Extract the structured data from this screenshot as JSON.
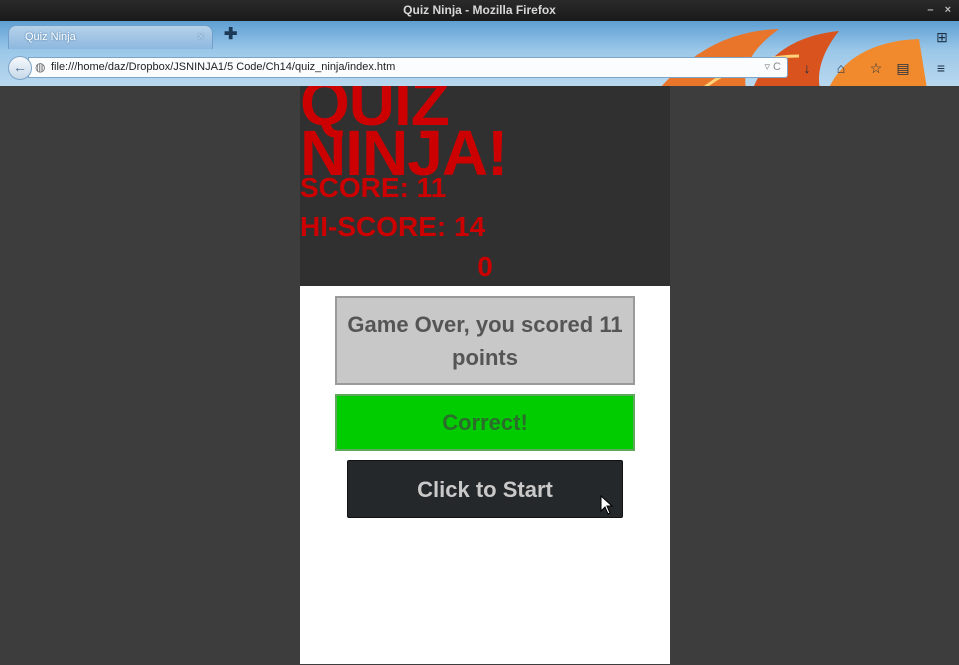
{
  "window": {
    "title": "Quiz Ninja - Mozilla Firefox",
    "controls": "– ×"
  },
  "browser": {
    "tab_label": "Quiz Ninja",
    "tab_close": "×",
    "new_tab": "✚",
    "back": "←",
    "url": "file:///home/daz/Dropbox/JSNINJA1/5 Code/Ch14/quiz_ninja/index.htm",
    "url_right": "▿ C",
    "icons": {
      "download": "↓",
      "home": "⌂",
      "bookmark": "☆",
      "bookmarks_list": "▤",
      "menu": "≡",
      "tab_groups": "⊞"
    }
  },
  "game": {
    "logo": "QUIZ NINJA!",
    "score": "SCORE: 11",
    "hiscore": "HI-SCORE: 14",
    "timer": "0",
    "question": "Game Over, you scored 11 points",
    "feedback": "Correct!",
    "start_button": "Click to Start"
  },
  "colors": {
    "accent_red": "#cc0000",
    "feedback_green": "#00cc00",
    "button_dark": "#25282b"
  }
}
